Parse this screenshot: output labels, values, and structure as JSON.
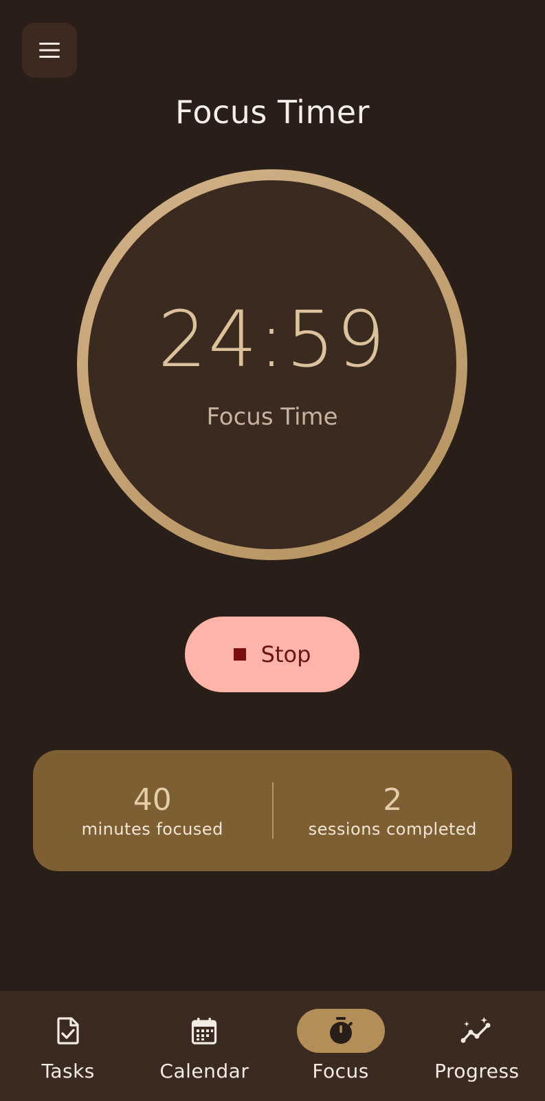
{
  "header": {
    "menu_icon": "hamburger-menu-icon",
    "title": "Focus Timer"
  },
  "timer": {
    "time": "24:59",
    "label": "Focus Time",
    "progress_fraction": 1.0,
    "ring_color": "#cfae84"
  },
  "controls": {
    "stop_icon": "stop-square-icon",
    "stop_label": "Stop",
    "stop_color": "#ffb4a9"
  },
  "stats": {
    "minutes_value": "40",
    "minutes_label": "minutes focused",
    "sessions_value": "2",
    "sessions_label": "sessions completed"
  },
  "nav": {
    "items": [
      {
        "label": "Tasks",
        "icon": "task-check-icon",
        "active": false
      },
      {
        "label": "Calendar",
        "icon": "calendar-icon",
        "active": false
      },
      {
        "label": "Focus",
        "icon": "timer-icon",
        "active": true
      },
      {
        "label": "Progress",
        "icon": "progress-chart-icon",
        "active": false
      }
    ]
  },
  "colors": {
    "background": "#2a1f18",
    "surface": "#3b2a20",
    "accent": "#b38e58",
    "stats_card": "#7e5e33"
  }
}
